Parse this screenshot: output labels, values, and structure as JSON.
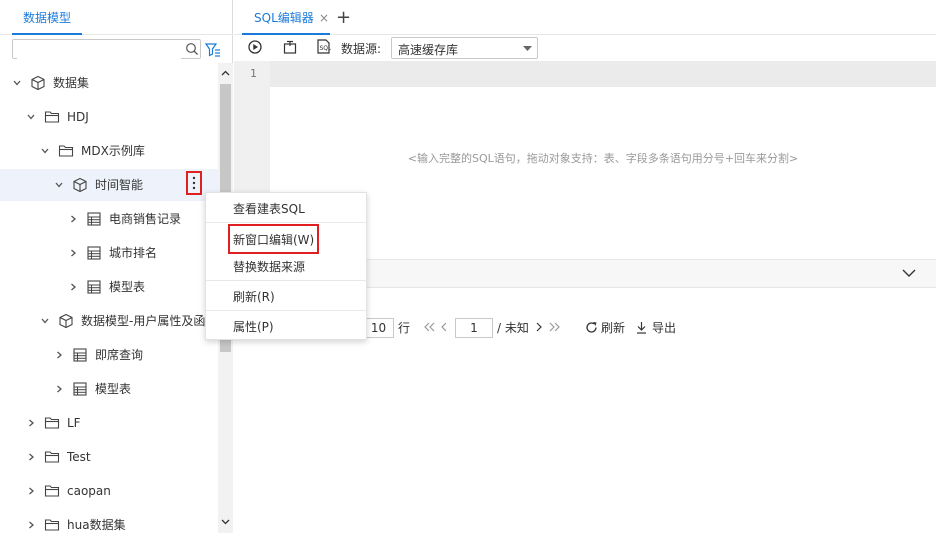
{
  "left_panel": {
    "tab_label": "数据模型",
    "search": {
      "value": "",
      "placeholder": ""
    },
    "tree": [
      {
        "label": "数据集",
        "icon": "cube-icon",
        "expanded": true
      },
      {
        "label": "HDJ",
        "icon": "folder-icon",
        "expanded": true
      },
      {
        "label": "MDX示例库",
        "icon": "folder-icon",
        "expanded": true
      },
      {
        "label": "时间智能",
        "icon": "cube-icon",
        "expanded": true
      },
      {
        "label": "电商销售记录",
        "icon": "table-icon",
        "expanded": false
      },
      {
        "label": "城市排名",
        "icon": "table-icon",
        "expanded": false
      },
      {
        "label": "模型表",
        "icon": "table-icon",
        "expanded": false
      },
      {
        "label": "数据模型-用户属性及函",
        "icon": "cube-icon",
        "expanded": true
      },
      {
        "label": "即席查询",
        "icon": "table-icon",
        "expanded": false
      },
      {
        "label": "模型表",
        "icon": "table-icon",
        "expanded": false
      },
      {
        "label": "LF",
        "icon": "folder-icon",
        "expanded": false
      },
      {
        "label": "Test",
        "icon": "folder-icon",
        "expanded": false
      },
      {
        "label": "caopan",
        "icon": "folder-icon",
        "expanded": false
      },
      {
        "label": "hua数据集",
        "icon": "folder-icon",
        "expanded": false
      }
    ]
  },
  "context_menu": {
    "items": [
      "查看建表SQL",
      "新窗口编辑(W)",
      "替换数据来源",
      "刷新(R)",
      "属性(P)"
    ]
  },
  "editor": {
    "tab_label": "SQL编辑器",
    "tab_close": "×",
    "add_tab": "+",
    "datasource_label": "数据源:",
    "datasource_value": "高速缓存库",
    "line_number": "1",
    "placeholder": "<输入完整的SQL语句，拖动对象支持：表、字段多条语句用分号+回车来分割>"
  },
  "pager": {
    "page_size": "10",
    "rows_label": "行",
    "page": "1",
    "total": "/ 未知",
    "refresh_label": "刷新",
    "export_label": "导出"
  },
  "colors": {
    "accent": "#1a7bdb",
    "highlight": "#e02020"
  }
}
